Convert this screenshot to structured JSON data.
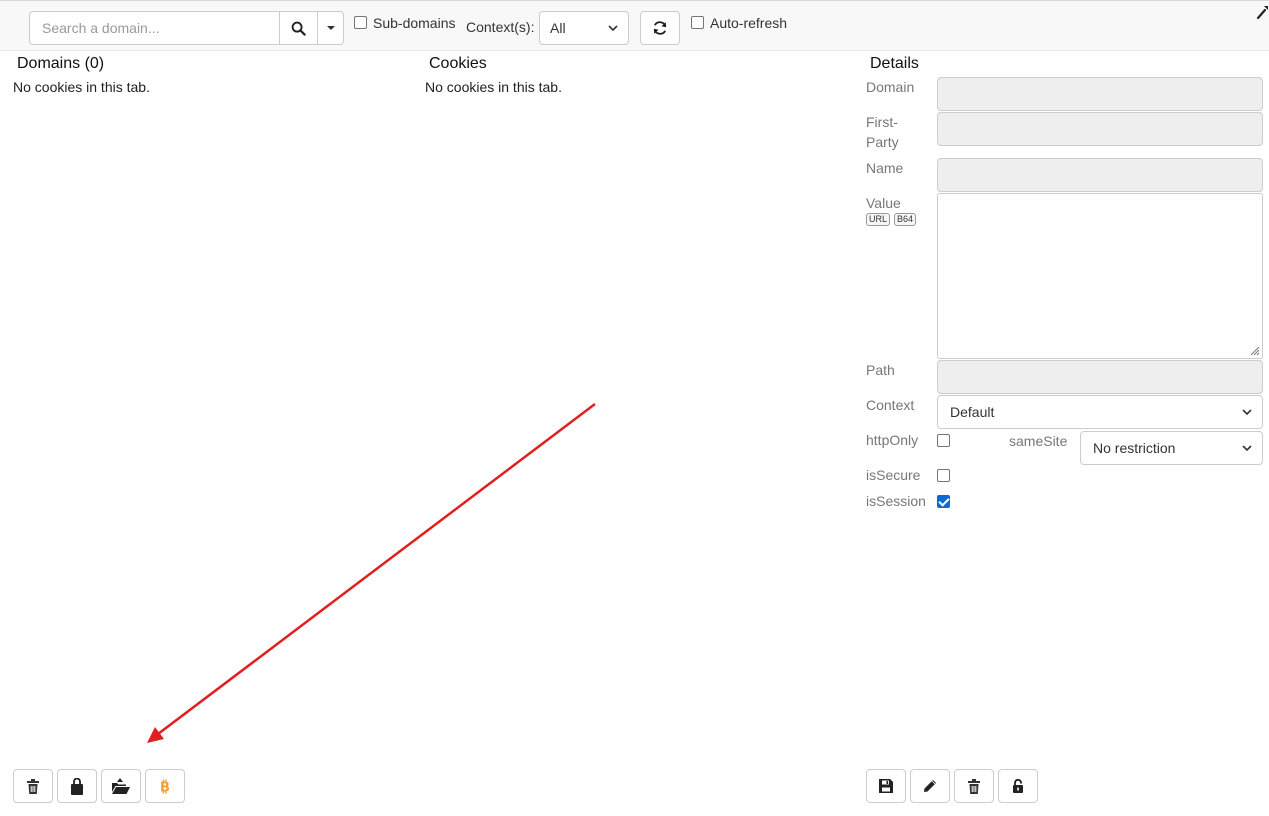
{
  "toolbar": {
    "search_placeholder": "Search a domain...",
    "search_value": "",
    "subdomains_label": "Sub-domains",
    "subdomains_checked": false,
    "contexts_label": "Context(s):",
    "contexts_selected": "All",
    "autorefresh_label": "Auto-refresh",
    "autorefresh_checked": false
  },
  "domains": {
    "title": "Domains (0)",
    "empty": "No cookies in this tab."
  },
  "cookies": {
    "title": "Cookies",
    "empty": "No cookies in this tab."
  },
  "details": {
    "title": "Details",
    "domain_label": "Domain",
    "first_party_label": "First-\nParty",
    "first_party_line1": "First-",
    "first_party_line2": "Party",
    "name_label": "Name",
    "value_label": "Value",
    "url_badge": "URL",
    "b64_badge": "B64",
    "path_label": "Path",
    "context_label": "Context",
    "context_selected": "Default",
    "httponly_label": "httpOnly",
    "samesite_label": "sameSite",
    "samesite_selected": "No restriction",
    "issecure_label": "isSecure",
    "issession_label": "isSession",
    "httponly_checked": false,
    "issecure_checked": false,
    "issession_checked": true
  },
  "icons": {
    "search": "search-icon",
    "refresh": "refresh-icon",
    "wrench": "wrench-icon",
    "trash": "trash-icon",
    "bag": "shopping-bag-icon",
    "folder": "folder-open-icon",
    "bitcoin": "bitcoin-icon",
    "save": "floppy-disk-icon",
    "pencil": "pencil-icon",
    "lock": "lock-icon"
  },
  "colors": {
    "accent_checkbox": "#0b6bd6",
    "bitcoin": "#f0a030",
    "annotation_arrow": "#e02020",
    "disabled_field": "#eeeeee"
  }
}
